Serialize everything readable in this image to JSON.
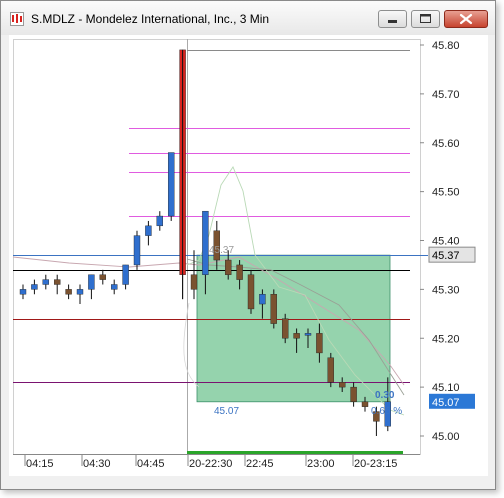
{
  "window": {
    "title": "S.MDLZ - Mondelez International, Inc., 3 Min",
    "min_icon": "minimize-icon",
    "max_icon": "maximize-icon",
    "close_icon": "close-icon"
  },
  "colors": {
    "up": "#2f6fce",
    "down": "#7a5230",
    "spike": "#d8231f",
    "pink": "#e05be0",
    "darkred": "#a01818",
    "purple": "#7a1370",
    "box": "#8fd1a9",
    "box_border": "#3c8f6a",
    "blue_line": "#3b73c2",
    "price_label_bg": "#2b78d6"
  },
  "chart_data": {
    "type": "candlestick",
    "symbol": "S.MDLZ",
    "x_tick_labels": [
      "04:15",
      "04:30",
      "04:45",
      "20-22:30",
      "22:45",
      "23:00",
      "20-23:15"
    ],
    "y_tick_labels": [
      "45.80",
      "45.70",
      "45.60",
      "45.50",
      "45.40",
      "45.30",
      "45.20",
      "45.10",
      "45.00"
    ],
    "ylim": [
      44.97,
      45.83
    ],
    "last_price_label": "45.07",
    "ref_price_label": "45.37",
    "box_top_label": "45.37",
    "box_bottom_label": "45.07",
    "box_right_label": "0.30",
    "box_percent_label": "0.66 %",
    "candles": [
      {
        "o": 45.29,
        "h": 45.31,
        "l": 45.28,
        "c": 45.3
      },
      {
        "o": 45.3,
        "h": 45.32,
        "l": 45.29,
        "c": 45.31
      },
      {
        "o": 45.31,
        "h": 45.33,
        "l": 45.3,
        "c": 45.32
      },
      {
        "o": 45.32,
        "h": 45.33,
        "l": 45.29,
        "c": 45.31
      },
      {
        "o": 45.3,
        "h": 45.31,
        "l": 45.28,
        "c": 45.29
      },
      {
        "o": 45.29,
        "h": 45.31,
        "l": 45.27,
        "c": 45.3
      },
      {
        "o": 45.3,
        "h": 45.33,
        "l": 45.28,
        "c": 45.33
      },
      {
        "o": 45.33,
        "h": 45.34,
        "l": 45.31,
        "c": 45.32
      },
      {
        "o": 45.3,
        "h": 45.32,
        "l": 45.29,
        "c": 45.31
      },
      {
        "o": 45.31,
        "h": 45.35,
        "l": 45.3,
        "c": 45.35
      },
      {
        "o": 45.35,
        "h": 45.42,
        "l": 45.34,
        "c": 45.41
      },
      {
        "o": 45.41,
        "h": 45.44,
        "l": 45.39,
        "c": 45.43
      },
      {
        "o": 45.43,
        "h": 45.46,
        "l": 45.42,
        "c": 45.45
      },
      {
        "o": 45.45,
        "h": 45.58,
        "l": 45.44,
        "c": 45.58
      },
      {
        "o": 45.33,
        "h": 45.79,
        "l": 45.28,
        "c": 45.79
      },
      {
        "o": 45.33,
        "h": 45.38,
        "l": 45.28,
        "c": 45.3
      },
      {
        "o": 45.33,
        "h": 45.44,
        "l": 45.29,
        "c": 45.46
      },
      {
        "o": 45.42,
        "h": 45.44,
        "l": 45.34,
        "c": 45.36
      },
      {
        "o": 45.36,
        "h": 45.38,
        "l": 45.32,
        "c": 45.33
      },
      {
        "o": 45.35,
        "h": 45.36,
        "l": 45.3,
        "c": 45.32
      },
      {
        "o": 45.33,
        "h": 45.34,
        "l": 45.25,
        "c": 45.26
      },
      {
        "o": 45.27,
        "h": 45.3,
        "l": 45.24,
        "c": 45.29
      },
      {
        "o": 45.29,
        "h": 45.3,
        "l": 45.22,
        "c": 45.23
      },
      {
        "o": 45.24,
        "h": 45.25,
        "l": 45.19,
        "c": 45.2
      },
      {
        "o": 45.21,
        "h": 45.22,
        "l": 45.17,
        "c": 45.2
      },
      {
        "o": 45.21,
        "h": 45.22,
        "l": 45.18,
        "c": 45.21
      },
      {
        "o": 45.21,
        "h": 45.23,
        "l": 45.15,
        "c": 45.17
      },
      {
        "o": 45.16,
        "h": 45.17,
        "l": 45.1,
        "c": 45.11
      },
      {
        "o": 45.11,
        "h": 45.12,
        "l": 45.09,
        "c": 45.1
      },
      {
        "o": 45.1,
        "h": 45.11,
        "l": 45.06,
        "c": 45.07
      },
      {
        "o": 45.07,
        "h": 45.08,
        "l": 45.05,
        "c": 45.06
      },
      {
        "o": 45.05,
        "h": 45.06,
        "l": 45.0,
        "c": 45.03
      },
      {
        "o": 45.02,
        "h": 45.12,
        "l": 45.01,
        "c": 45.07
      }
    ],
    "horizontal_lines": [
      {
        "price": 45.79,
        "color": "#8a8a8a"
      },
      {
        "price": 45.63,
        "color": "#e05be0"
      },
      {
        "price": 45.58,
        "color": "#e05be0"
      },
      {
        "price": 45.54,
        "color": "#e05be0"
      },
      {
        "price": 45.45,
        "color": "#e05be0"
      },
      {
        "price": 45.34,
        "color": "#000000"
      },
      {
        "price": 45.24,
        "color": "#a01818"
      },
      {
        "price": 45.11,
        "color": "#7a1370"
      },
      {
        "price": 45.37,
        "color": "#3b73c2"
      }
    ]
  }
}
